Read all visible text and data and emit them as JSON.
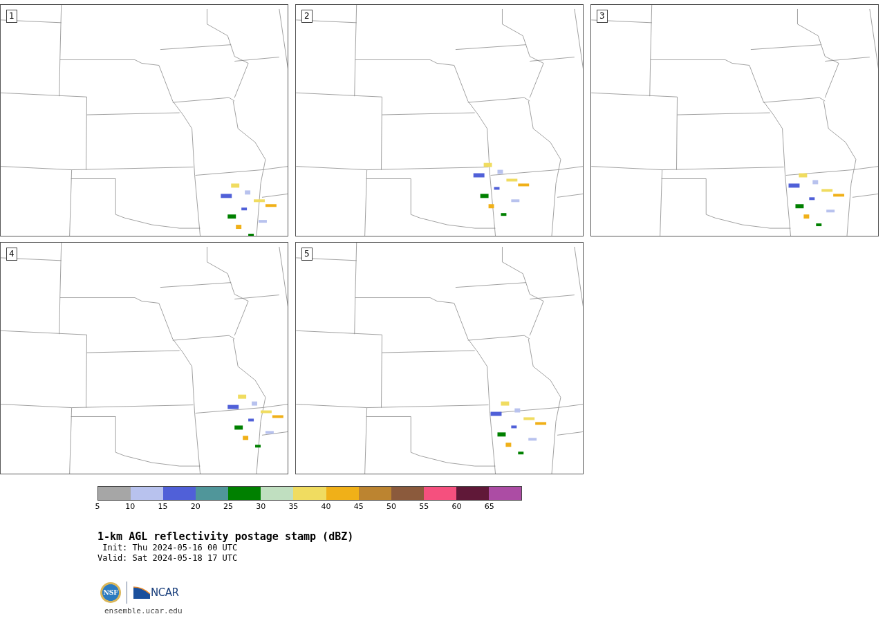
{
  "panels": [
    {
      "label": "1"
    },
    {
      "label": "2"
    },
    {
      "label": "3"
    },
    {
      "label": "4"
    },
    {
      "label": "5"
    }
  ],
  "colorbar": {
    "bins": [
      {
        "color": "#a6a6a6"
      },
      {
        "color": "#b8c2ee"
      },
      {
        "color": "#5060d8"
      },
      {
        "color": "#50969a"
      },
      {
        "color": "#008000"
      },
      {
        "color": "#c0dfc0"
      },
      {
        "color": "#f0dc60"
      },
      {
        "color": "#f0b018"
      },
      {
        "color": "#bc8430"
      },
      {
        "color": "#8b5a3c"
      },
      {
        "color": "#f5507e"
      },
      {
        "color": "#601838"
      },
      {
        "color": "#ac4ca4"
      }
    ],
    "ticks": [
      "5",
      "10",
      "15",
      "20",
      "25",
      "30",
      "35",
      "40",
      "45",
      "50",
      "55",
      "60",
      "65"
    ]
  },
  "title": "1-km AGL reflectivity postage stamp (dBZ)",
  "init": " Init: Thu 2024-05-16 00 UTC",
  "valid": "Valid: Sat 2024-05-18 17 UTC",
  "logos": {
    "nsf": "NSF",
    "ncar": "NCAR"
  },
  "site": "ensemble.ucar.edu"
}
